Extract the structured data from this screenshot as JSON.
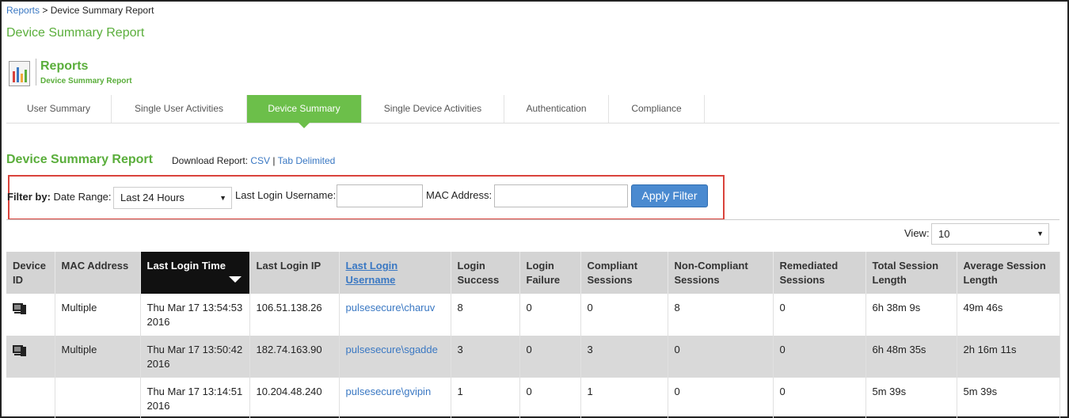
{
  "breadcrumb": {
    "link": "Reports",
    "separator": " > ",
    "current": "Device Summary Report"
  },
  "page_title": "Device Summary Report",
  "report_header": {
    "title": "Reports",
    "subtitle": "Device Summary Report"
  },
  "tabs": [
    {
      "label": "User Summary",
      "active": false
    },
    {
      "label": "Single User Activities",
      "active": false
    },
    {
      "label": "Device Summary",
      "active": true
    },
    {
      "label": "Single Device Activities",
      "active": false
    },
    {
      "label": "Authentication",
      "active": false
    },
    {
      "label": "Compliance",
      "active": false
    }
  ],
  "section": {
    "title": "Device Summary Report",
    "download_label": "Download Report: ",
    "download_csv": "CSV",
    "download_separator": " | ",
    "download_tab": "Tab Delimited"
  },
  "filter": {
    "filter_by": "Filter by:",
    "date_range_label": " Date Range:",
    "date_range_value": "Last 24 Hours",
    "username_label": "Last Login Username:",
    "username_value": "",
    "mac_label": "MAC Address:",
    "mac_value": "",
    "apply_label": "Apply Filter"
  },
  "view": {
    "label": "View:",
    "value": "10"
  },
  "table": {
    "headers": [
      "Device ID",
      "MAC Address",
      "Last Login Time",
      "Last Login IP",
      "Last Login Username",
      "Login Success",
      "Login Failure",
      "Compliant Sessions",
      "Non-Compliant Sessions",
      "Remediated Sessions",
      "Total Session Length",
      "Average Session Length"
    ],
    "sorted_column": "Last Login Time",
    "rows": [
      {
        "device_icon": "computer-icon",
        "mac": "Multiple",
        "time": "Thu Mar 17 13:54:53 2016",
        "ip": "106.51.138.26",
        "user": "pulsesecure\\charuv",
        "success": "8",
        "failure": "0",
        "compliant": "0",
        "noncompliant": "8",
        "remediated": "0",
        "total": "6h 38m 9s",
        "average": "49m 46s"
      },
      {
        "device_icon": "computer-icon",
        "mac": "Multiple",
        "time": "Thu Mar 17 13:50:42 2016",
        "ip": "182.74.163.90",
        "user": "pulsesecure\\sgadde",
        "success": "3",
        "failure": "0",
        "compliant": "3",
        "noncompliant": "0",
        "remediated": "0",
        "total": "6h 48m 35s",
        "average": "2h 16m 11s"
      },
      {
        "device_icon": "",
        "mac": "",
        "time": "Thu Mar 17 13:14:51 2016",
        "ip": "10.204.48.240",
        "user": "pulsesecure\\gvipin",
        "success": "1",
        "failure": "0",
        "compliant": "1",
        "noncompliant": "0",
        "remediated": "0",
        "total": "5m 39s",
        "average": "5m 39s"
      }
    ]
  },
  "colors": {
    "accent_green": "#5aae3b",
    "active_tab": "#6cbf4a",
    "link_blue": "#3a78c3",
    "highlight_red": "#d9433c",
    "button_blue": "#4a8ad0"
  }
}
